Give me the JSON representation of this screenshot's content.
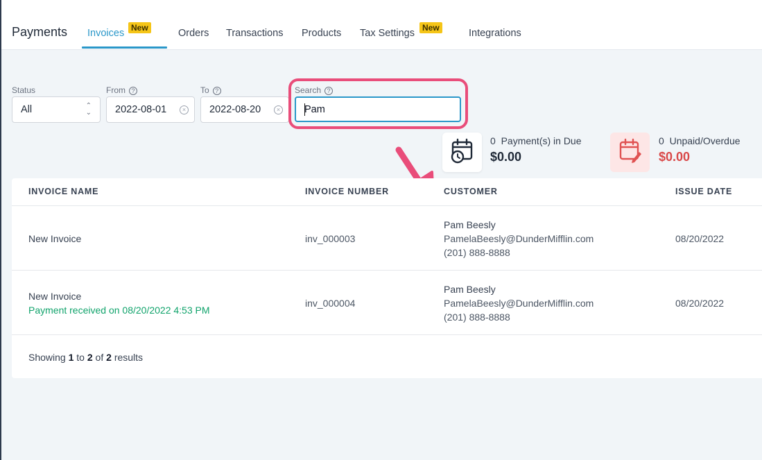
{
  "app": {
    "title": "Payments"
  },
  "tabs": [
    {
      "label": "Invoices",
      "badge": "New",
      "active": true
    },
    {
      "label": "Orders"
    },
    {
      "label": "Transactions"
    },
    {
      "label": "Products"
    },
    {
      "label": "Tax Settings",
      "badge": "New"
    },
    {
      "label": "Integrations"
    }
  ],
  "filters": {
    "status": {
      "label": "Status",
      "value": "All"
    },
    "from": {
      "label": "From",
      "value": "2022-08-01"
    },
    "to": {
      "label": "To",
      "value": "2022-08-20"
    },
    "search": {
      "label": "Search",
      "value": "Pam"
    }
  },
  "stats": {
    "due": {
      "count": "0",
      "label": "Payment(s) in Due",
      "amount": "$0.00"
    },
    "unpaid": {
      "count": "0",
      "label": "Unpaid/Overdue",
      "amount": "$0.00"
    }
  },
  "table": {
    "headers": [
      "INVOICE NAME",
      "INVOICE NUMBER",
      "CUSTOMER",
      "ISSUE DATE"
    ],
    "rows": [
      {
        "name": "New Invoice",
        "note": "",
        "number": "inv_000003",
        "customer_name": "Pam Beesly",
        "customer_email": "PamelaBeesly@DunderMifflin.com",
        "customer_phone": "(201) 888-8888",
        "issue_date": "08/20/2022"
      },
      {
        "name": "New Invoice",
        "note": "Payment received on 08/20/2022 4:53 PM",
        "number": "inv_000004",
        "customer_name": "Pam Beesly",
        "customer_email": "PamelaBeesly@DunderMifflin.com",
        "customer_phone": "(201) 888-8888",
        "issue_date": "08/20/2022"
      }
    ],
    "footer": {
      "prefix": "Showing",
      "from": "1",
      "to_word": "to",
      "to": "2",
      "of_word": "of",
      "total": "2",
      "suffix": "results"
    }
  },
  "colors": {
    "accent": "#2a97c9",
    "badge": "#f5c518",
    "highlight": "#e94d7a",
    "success": "#10a36b",
    "danger": "#d94848"
  }
}
